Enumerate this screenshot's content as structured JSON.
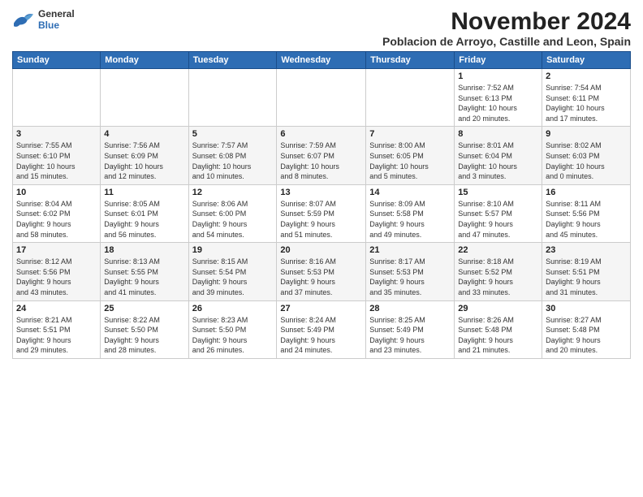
{
  "logo": {
    "general": "General",
    "blue": "Blue"
  },
  "title": "November 2024",
  "location": "Poblacion de Arroyo, Castille and Leon, Spain",
  "days_header": [
    "Sunday",
    "Monday",
    "Tuesday",
    "Wednesday",
    "Thursday",
    "Friday",
    "Saturday"
  ],
  "weeks": [
    [
      {
        "day": "",
        "info": ""
      },
      {
        "day": "",
        "info": ""
      },
      {
        "day": "",
        "info": ""
      },
      {
        "day": "",
        "info": ""
      },
      {
        "day": "",
        "info": ""
      },
      {
        "day": "1",
        "info": "Sunrise: 7:52 AM\nSunset: 6:13 PM\nDaylight: 10 hours\nand 20 minutes."
      },
      {
        "day": "2",
        "info": "Sunrise: 7:54 AM\nSunset: 6:11 PM\nDaylight: 10 hours\nand 17 minutes."
      }
    ],
    [
      {
        "day": "3",
        "info": "Sunrise: 7:55 AM\nSunset: 6:10 PM\nDaylight: 10 hours\nand 15 minutes."
      },
      {
        "day": "4",
        "info": "Sunrise: 7:56 AM\nSunset: 6:09 PM\nDaylight: 10 hours\nand 12 minutes."
      },
      {
        "day": "5",
        "info": "Sunrise: 7:57 AM\nSunset: 6:08 PM\nDaylight: 10 hours\nand 10 minutes."
      },
      {
        "day": "6",
        "info": "Sunrise: 7:59 AM\nSunset: 6:07 PM\nDaylight: 10 hours\nand 8 minutes."
      },
      {
        "day": "7",
        "info": "Sunrise: 8:00 AM\nSunset: 6:05 PM\nDaylight: 10 hours\nand 5 minutes."
      },
      {
        "day": "8",
        "info": "Sunrise: 8:01 AM\nSunset: 6:04 PM\nDaylight: 10 hours\nand 3 minutes."
      },
      {
        "day": "9",
        "info": "Sunrise: 8:02 AM\nSunset: 6:03 PM\nDaylight: 10 hours\nand 0 minutes."
      }
    ],
    [
      {
        "day": "10",
        "info": "Sunrise: 8:04 AM\nSunset: 6:02 PM\nDaylight: 9 hours\nand 58 minutes."
      },
      {
        "day": "11",
        "info": "Sunrise: 8:05 AM\nSunset: 6:01 PM\nDaylight: 9 hours\nand 56 minutes."
      },
      {
        "day": "12",
        "info": "Sunrise: 8:06 AM\nSunset: 6:00 PM\nDaylight: 9 hours\nand 54 minutes."
      },
      {
        "day": "13",
        "info": "Sunrise: 8:07 AM\nSunset: 5:59 PM\nDaylight: 9 hours\nand 51 minutes."
      },
      {
        "day": "14",
        "info": "Sunrise: 8:09 AM\nSunset: 5:58 PM\nDaylight: 9 hours\nand 49 minutes."
      },
      {
        "day": "15",
        "info": "Sunrise: 8:10 AM\nSunset: 5:57 PM\nDaylight: 9 hours\nand 47 minutes."
      },
      {
        "day": "16",
        "info": "Sunrise: 8:11 AM\nSunset: 5:56 PM\nDaylight: 9 hours\nand 45 minutes."
      }
    ],
    [
      {
        "day": "17",
        "info": "Sunrise: 8:12 AM\nSunset: 5:56 PM\nDaylight: 9 hours\nand 43 minutes."
      },
      {
        "day": "18",
        "info": "Sunrise: 8:13 AM\nSunset: 5:55 PM\nDaylight: 9 hours\nand 41 minutes."
      },
      {
        "day": "19",
        "info": "Sunrise: 8:15 AM\nSunset: 5:54 PM\nDaylight: 9 hours\nand 39 minutes."
      },
      {
        "day": "20",
        "info": "Sunrise: 8:16 AM\nSunset: 5:53 PM\nDaylight: 9 hours\nand 37 minutes."
      },
      {
        "day": "21",
        "info": "Sunrise: 8:17 AM\nSunset: 5:53 PM\nDaylight: 9 hours\nand 35 minutes."
      },
      {
        "day": "22",
        "info": "Sunrise: 8:18 AM\nSunset: 5:52 PM\nDaylight: 9 hours\nand 33 minutes."
      },
      {
        "day": "23",
        "info": "Sunrise: 8:19 AM\nSunset: 5:51 PM\nDaylight: 9 hours\nand 31 minutes."
      }
    ],
    [
      {
        "day": "24",
        "info": "Sunrise: 8:21 AM\nSunset: 5:51 PM\nDaylight: 9 hours\nand 29 minutes."
      },
      {
        "day": "25",
        "info": "Sunrise: 8:22 AM\nSunset: 5:50 PM\nDaylight: 9 hours\nand 28 minutes."
      },
      {
        "day": "26",
        "info": "Sunrise: 8:23 AM\nSunset: 5:50 PM\nDaylight: 9 hours\nand 26 minutes."
      },
      {
        "day": "27",
        "info": "Sunrise: 8:24 AM\nSunset: 5:49 PM\nDaylight: 9 hours\nand 24 minutes."
      },
      {
        "day": "28",
        "info": "Sunrise: 8:25 AM\nSunset: 5:49 PM\nDaylight: 9 hours\nand 23 minutes."
      },
      {
        "day": "29",
        "info": "Sunrise: 8:26 AM\nSunset: 5:48 PM\nDaylight: 9 hours\nand 21 minutes."
      },
      {
        "day": "30",
        "info": "Sunrise: 8:27 AM\nSunset: 5:48 PM\nDaylight: 9 hours\nand 20 minutes."
      }
    ]
  ]
}
